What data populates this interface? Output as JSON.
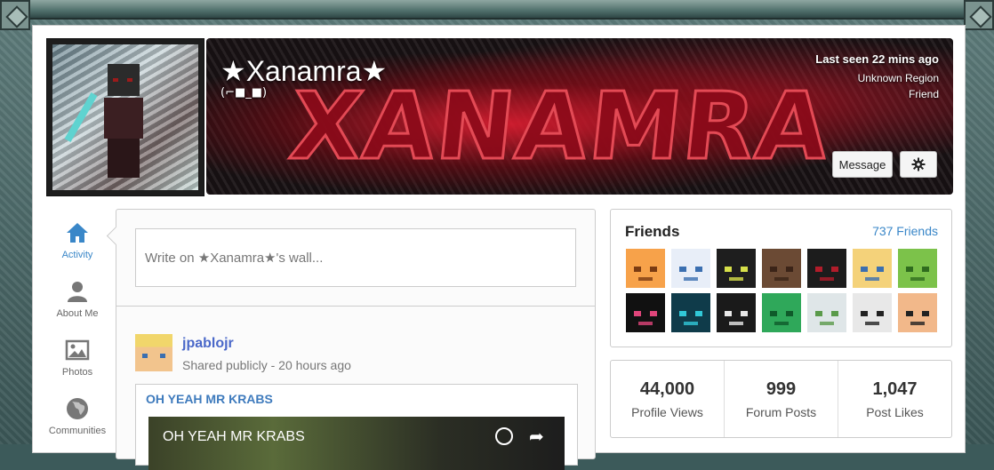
{
  "profile": {
    "username": "★Xanamra★",
    "subtitle": "(⌐■_■)",
    "banner_text": "XANAMRA",
    "last_seen": "Last seen 22 mins ago",
    "region": "Unknown Region",
    "relation": "Friend",
    "message_label": "Message",
    "settings_icon": "gear-icon"
  },
  "nav": [
    {
      "label": "Activity",
      "icon": "home-icon",
      "active": true
    },
    {
      "label": "About Me",
      "icon": "user-icon",
      "active": false
    },
    {
      "label": "Photos",
      "icon": "image-icon",
      "active": false
    },
    {
      "label": "Communities",
      "icon": "globe-icon",
      "active": false
    }
  ],
  "wall": {
    "placeholder": "Write on ★Xanamra★'s wall..."
  },
  "post": {
    "author": "jpablojr",
    "meta": "Shared publicly - 20 hours ago",
    "share_title": "OH YEAH MR KRABS",
    "video_title": "OH YEAH MR KRABS"
  },
  "friends": {
    "title": "Friends",
    "count": "737 Friends",
    "avatars": [
      {
        "bg": "#f7a24a",
        "fg": "#7a3b12"
      },
      {
        "bg": "#e8eef8",
        "fg": "#3b6fb0"
      },
      {
        "bg": "#1e1e1e",
        "fg": "#d7e04a"
      },
      {
        "bg": "#6b4a34",
        "fg": "#3b2418"
      },
      {
        "bg": "#1c1c1c",
        "fg": "#b11c2a"
      },
      {
        "bg": "#f4d27a",
        "fg": "#3b6fb0"
      },
      {
        "bg": "#7cc24a",
        "fg": "#2f6b1e"
      },
      {
        "bg": "#111111",
        "fg": "#e0457a"
      },
      {
        "bg": "#0f3b4a",
        "fg": "#31c8d8"
      },
      {
        "bg": "#1a1a1a",
        "fg": "#e8e8e8"
      },
      {
        "bg": "#2fa85a",
        "fg": "#0f5a2a"
      },
      {
        "bg": "#dfe6e8",
        "fg": "#5a9a4a"
      },
      {
        "bg": "#e8e8e8",
        "fg": "#222222"
      },
      {
        "bg": "#f2b88a",
        "fg": "#222222"
      }
    ]
  },
  "stats": [
    {
      "value": "44,000",
      "label": "Profile Views"
    },
    {
      "value": "999",
      "label": "Forum Posts"
    },
    {
      "value": "1,047",
      "label": "Post Likes"
    }
  ],
  "colors": {
    "accent": "#3a87c8",
    "author_link": "#4a68c9"
  }
}
